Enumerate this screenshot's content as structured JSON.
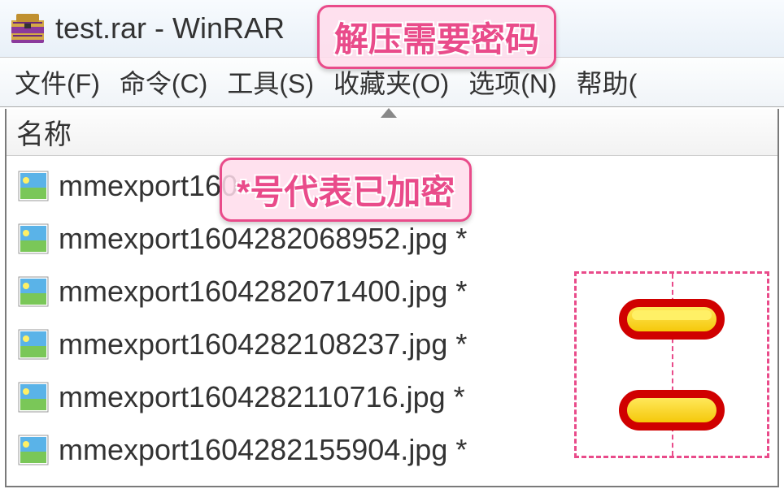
{
  "title": {
    "text": "test.rar - WinRAR"
  },
  "menu": {
    "items": [
      {
        "label": "文件(F)"
      },
      {
        "label": "命令(C)"
      },
      {
        "label": "工具(S)"
      },
      {
        "label": "收藏夹(O)"
      },
      {
        "label": "选项(N)"
      },
      {
        "label": "帮助("
      }
    ]
  },
  "columnHeader": "名称",
  "files": [
    {
      "name": "mmexport160"
    },
    {
      "name": "mmexport1604282068952.jpg *"
    },
    {
      "name": "mmexport1604282071400.jpg *"
    },
    {
      "name": "mmexport1604282108237.jpg *"
    },
    {
      "name": "mmexport1604282110716.jpg *"
    },
    {
      "name": "mmexport1604282155904.jpg *"
    }
  ],
  "annotations": {
    "top": "解压需要密码",
    "mid": "*号代表已加密"
  }
}
